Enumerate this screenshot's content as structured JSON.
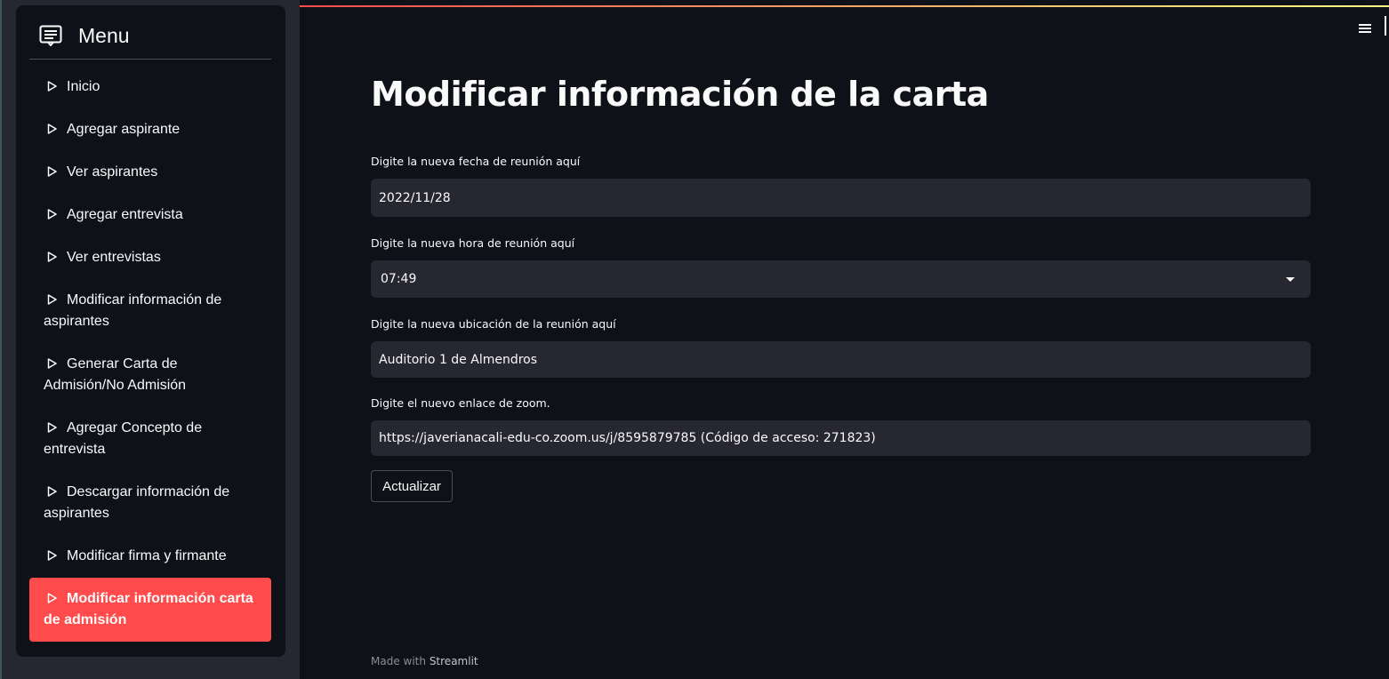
{
  "sidebar": {
    "title": "Menu",
    "items": [
      {
        "label": "Inicio",
        "active": false
      },
      {
        "label": "Agregar aspirante",
        "active": false
      },
      {
        "label": "Ver aspirantes",
        "active": false
      },
      {
        "label": "Agregar entrevista",
        "active": false
      },
      {
        "label": "Ver entrevistas",
        "active": false
      },
      {
        "label": "Modificar información de aspirantes",
        "active": false
      },
      {
        "label": "Generar Carta de Admisión/No Admisión",
        "active": false
      },
      {
        "label": "Agregar Concepto de entrevista",
        "active": false
      },
      {
        "label": "Descargar información de aspirantes",
        "active": false
      },
      {
        "label": "Modificar firma y firmante",
        "active": false
      },
      {
        "label": "Modificar información carta de admisión",
        "active": true
      }
    ]
  },
  "main": {
    "title": "Modificar información de la carta",
    "fields": {
      "date": {
        "label": "Digite la nueva fecha de reunión aquí",
        "value": "2022/11/28"
      },
      "time": {
        "label": "Digite la nueva hora de reunión aquí",
        "value": "07:49"
      },
      "location": {
        "label": "Digite la nueva ubicación de la reunión aquí",
        "value": "Auditorio 1 de Almendros"
      },
      "zoom": {
        "label": "Digite el nuevo enlace de zoom.",
        "value": "https://javerianacali-edu-co.zoom.us/j/8595879785 (Código de acceso: 271823)"
      }
    },
    "submit_label": "Actualizar"
  },
  "footer": {
    "prefix": "Made with",
    "brand": "Streamlit"
  },
  "colors": {
    "accent": "#ff4b4b",
    "background": "#0e1117",
    "sidebar": "#262730",
    "input": "#262730"
  }
}
